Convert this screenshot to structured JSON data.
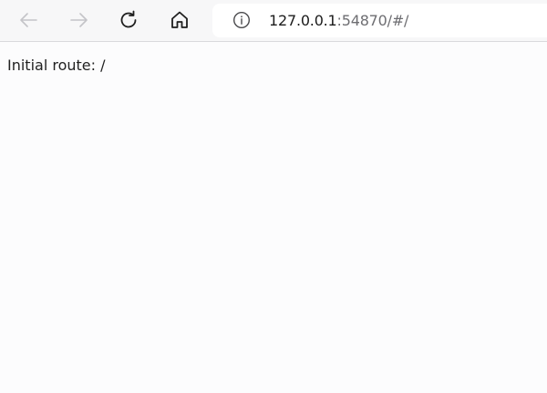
{
  "toolbar": {
    "back_icon": "arrow-left-icon",
    "forward_icon": "arrow-right-icon",
    "refresh_icon": "refresh-icon",
    "home_icon": "home-icon"
  },
  "address_bar": {
    "info_icon": "info-icon",
    "url_host": "127.0.0.1",
    "url_rest": ":54870/#/"
  },
  "page": {
    "text": "Initial route: /"
  },
  "colors": {
    "toolbar_bg": "#f7f7f8",
    "page_bg": "#fcfcfd",
    "disabled_icon": "#c4c4c8",
    "active_icon": "#1f1f1f"
  }
}
